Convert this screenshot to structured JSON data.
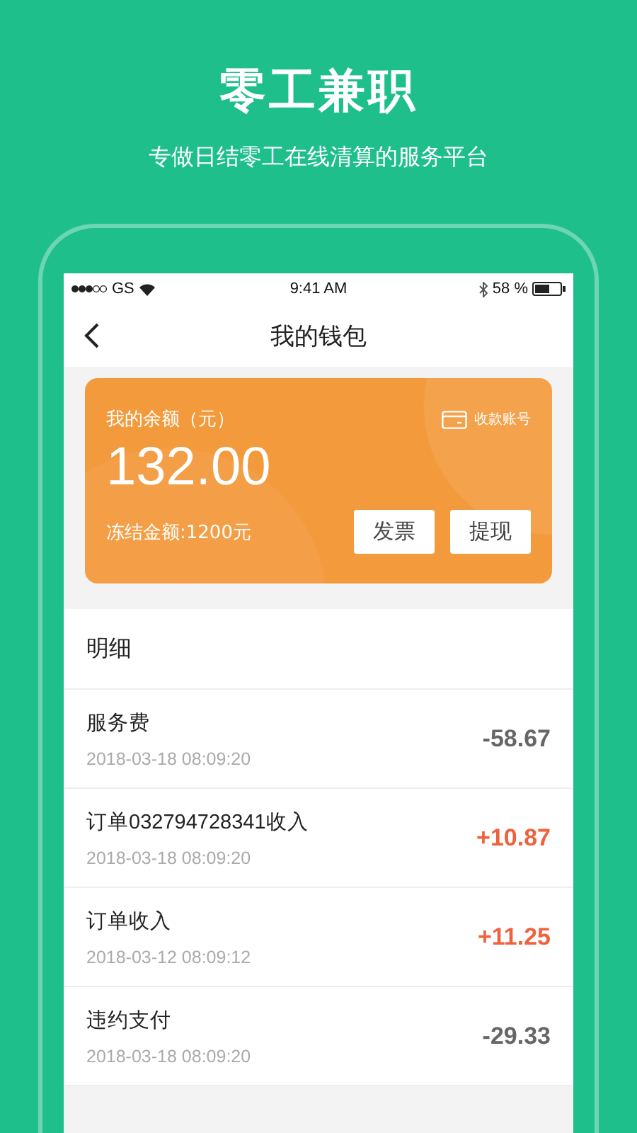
{
  "headline": "零工兼职",
  "tagline": "专做日结零工在线清算的服务平台",
  "status_bar": {
    "carrier": "GS",
    "time": "9:41 AM",
    "battery": "58 %"
  },
  "nav": {
    "title": "我的钱包"
  },
  "wallet": {
    "balance_label": "我的余额（元）",
    "balance": "132.00",
    "account_link": "收款账号",
    "frozen": "冻结金额:1200元",
    "buttons": [
      "发票",
      "提现"
    ]
  },
  "details": {
    "title": "明细",
    "items": [
      {
        "title": "服务费",
        "date": "2018-03-18 08:09:20",
        "amount": "-58.67",
        "kind": "expense"
      },
      {
        "title": "订单032794728341收入",
        "date": "2018-03-18 08:09:20",
        "amount": "+10.87",
        "kind": "income"
      },
      {
        "title": "订单收入",
        "date": "2018-03-12 08:09:12",
        "amount": "+11.25",
        "kind": "income"
      },
      {
        "title": "违约支付",
        "date": "2018-03-18 08:09:20",
        "amount": "-29.33",
        "kind": "expense"
      }
    ]
  }
}
